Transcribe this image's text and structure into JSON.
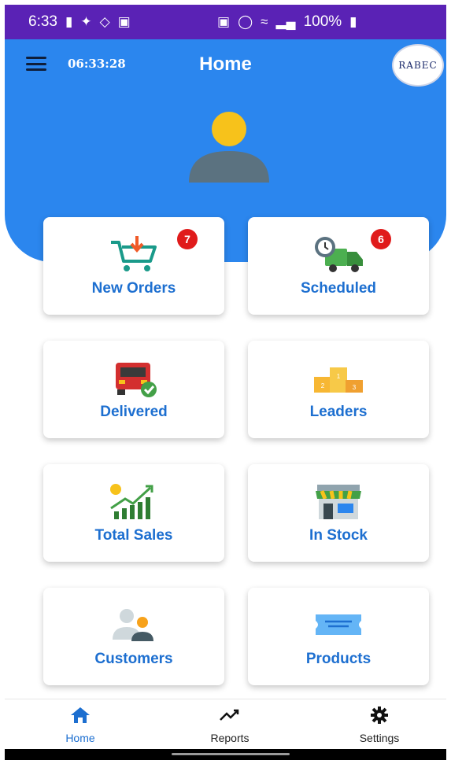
{
  "status_bar": {
    "time": "6:33",
    "battery": "100%",
    "left_icons": [
      "message-icon",
      "twitter-icon",
      "shield-wifi-icon",
      "image-icon"
    ],
    "right_icons": [
      "lock-icon",
      "alarm-icon",
      "wifi-icon",
      "signal-icon",
      "battery-icon"
    ]
  },
  "header": {
    "clock": "06:33:28",
    "title": "Home",
    "logo_text": "RABEC",
    "color": "#2b86ee"
  },
  "cards": [
    {
      "label": "New Orders",
      "icon": "cart-icon",
      "badge": "7"
    },
    {
      "label": "Scheduled",
      "icon": "delivery-truck-clock-icon",
      "badge": "6"
    },
    {
      "label": "Delivered",
      "icon": "truck-check-icon"
    },
    {
      "label": "Leaders",
      "icon": "podium-icon"
    },
    {
      "label": "Total Sales",
      "icon": "sales-chart-icon"
    },
    {
      "label": "In Stock",
      "icon": "store-icon"
    },
    {
      "label": "Customers",
      "icon": "people-icon"
    },
    {
      "label": "Products",
      "icon": "ticket-icon"
    }
  ],
  "bottom_nav": [
    {
      "label": "Home",
      "icon": "home-icon",
      "active": true
    },
    {
      "label": "Reports",
      "icon": "trend-icon",
      "active": false
    },
    {
      "label": "Settings",
      "icon": "gear-icon",
      "active": false
    }
  ],
  "colors": {
    "status_bar": "#5a22b5",
    "primary": "#2b86ee",
    "card_label": "#1d6fd0",
    "badge": "#e01b1b"
  }
}
